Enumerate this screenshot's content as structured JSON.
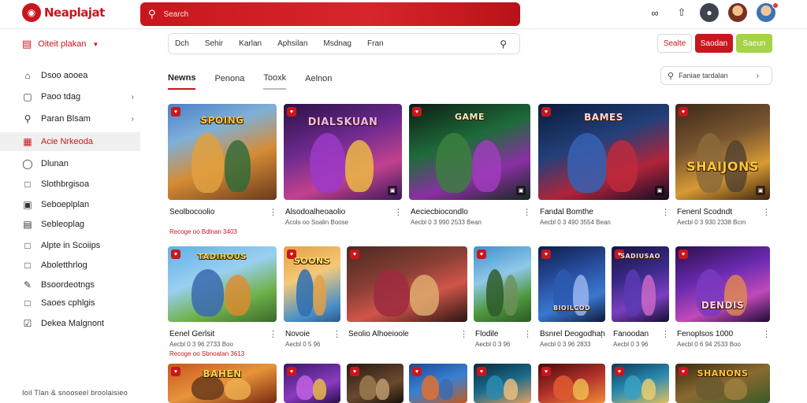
{
  "app": {
    "logo_text": "Neaplajat",
    "logo_sub": ""
  },
  "top_search": {
    "placeholder": "Search"
  },
  "sidebar": {
    "header": "Oiteit plakan",
    "items": [
      {
        "label": "Dsoo aooea",
        "icon": "home-icon"
      },
      {
        "label": "Paoo tdag",
        "icon": "tag-icon"
      },
      {
        "label": "Paran Blsam",
        "icon": "search-icon"
      },
      {
        "label": "Acie Nrkeoda",
        "icon": "folder-icon"
      },
      {
        "label": "Dlunan",
        "icon": "shield-icon"
      },
      {
        "label": "Slothbrgisoa",
        "icon": "gamepad-icon"
      },
      {
        "label": "Seboeplplan",
        "icon": "grid-icon"
      },
      {
        "label": "Sebleoplag",
        "icon": "list-icon"
      },
      {
        "label": "Alpte in Scoiips",
        "icon": "box-icon"
      },
      {
        "label": "Aboletthrlog",
        "icon": "bookmark-icon"
      },
      {
        "label": "Bsoordeotngs",
        "icon": "edit-icon"
      },
      {
        "label": "Saoes cphlgis",
        "icon": "flag-icon"
      },
      {
        "label": "Dekea Malgnont",
        "icon": "check-icon"
      }
    ],
    "footer": "Ioil Tlan & snooseel broolaisieo"
  },
  "category_bar": {
    "items": [
      "Dch",
      "Sehir",
      "Karlan",
      "Aphsilan",
      "Msdnag",
      "Fran"
    ]
  },
  "buttons": {
    "outline": "Sealte",
    "red": "Saodan",
    "green": "Saeun"
  },
  "tabs": [
    "Newns",
    "Penona",
    "Tooxk",
    "Aelnon"
  ],
  "sort": {
    "label": "Faniae tardalan"
  },
  "games": [
    {
      "title": "Seolbocoolio",
      "meta": "",
      "price": "Recoge oo Bdlnan 3403",
      "art": "SPOING"
    },
    {
      "title": "Alsodoalheoaolio",
      "meta": "Acols oo Soalin Boose",
      "price": "",
      "art": "DIALSKUAN"
    },
    {
      "title": "Aeciecbiocondlo",
      "meta": "Aecbl 0 3 990 2533 Bean",
      "price": "",
      "art": "GAME"
    },
    {
      "title": "Fandal Bomthe",
      "meta": "Aecbl 0 3 490 3554 Bean",
      "price": "",
      "art": "BAMES"
    },
    {
      "title": "Fenenl Scodndt",
      "meta": "Aecbl 0 3 930 2338 Bcm",
      "price": "",
      "art": "SHAIJONS"
    },
    {
      "title": "Eenel Gerlsit",
      "meta": "Aecbl 0 3 96 2733 Boo",
      "price": "Recoge oo Sbnoatan 3613",
      "art": "TADIHOUS"
    },
    {
      "title": "Novoie",
      "meta": "Aecbl 0 5 96",
      "price": "",
      "art": "SOONS"
    },
    {
      "title": "Seolio Alhoeioole",
      "meta": "",
      "price": "",
      "art": ""
    },
    {
      "title": "Flodile",
      "meta": "Aecbl 0 3 96",
      "price": "",
      "art": ""
    },
    {
      "title": "Bsnrel Deogodhan",
      "meta": "Aecbl 0 3 96 2833",
      "price": "",
      "art": "BIOILCOD"
    },
    {
      "title": "Fanoodan",
      "meta": "Aecbl 0 3 96",
      "price": "",
      "art": "SADIUSAO"
    },
    {
      "title": "Fenoplsos 1000",
      "meta": "Aecbl 0 6 94 2533 Boo",
      "price": "",
      "art": "DENDIS"
    },
    {
      "title": "",
      "meta": "",
      "price": "",
      "art": "BAHEN"
    },
    {
      "title": "",
      "meta": "",
      "price": "",
      "art": ""
    },
    {
      "title": "",
      "meta": "",
      "price": "",
      "art": ""
    },
    {
      "title": "",
      "meta": "",
      "price": "",
      "art": ""
    },
    {
      "title": "",
      "meta": "",
      "price": "",
      "art": ""
    },
    {
      "title": "",
      "meta": "",
      "price": "",
      "art": ""
    },
    {
      "title": "",
      "meta": "",
      "price": "",
      "art": ""
    },
    {
      "title": "",
      "meta": "",
      "price": "",
      "art": "SHANONS"
    }
  ],
  "colors": {
    "brand_red": "#c8161d",
    "accent_green": "#a6d246"
  }
}
